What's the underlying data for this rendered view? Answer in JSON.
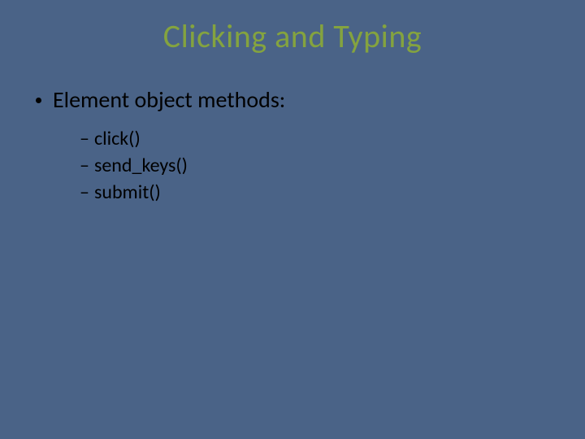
{
  "slide": {
    "title": "Clicking and Typing",
    "bullet": "Element object methods:",
    "subitems": {
      "s0": "click()",
      "s1": "send_keys()",
      "s2": "submit()"
    }
  }
}
